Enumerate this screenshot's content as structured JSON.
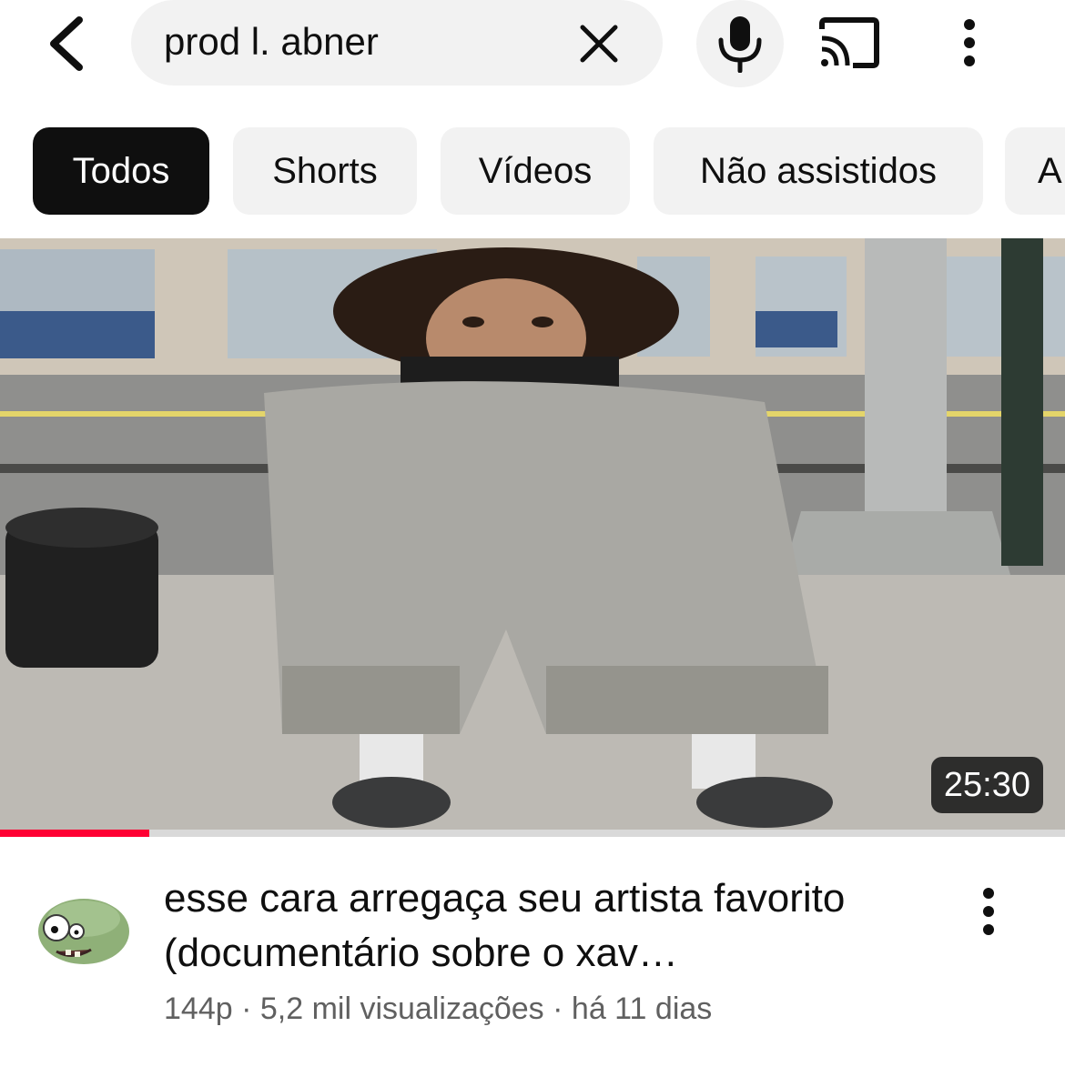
{
  "search": {
    "query": "prod l. abner"
  },
  "icons": {
    "back": "chevron-left-icon",
    "clear": "close-icon",
    "mic": "microphone-icon",
    "cast": "cast-icon",
    "more": "more-vertical-icon"
  },
  "chips": [
    {
      "label": "Todos",
      "active": true
    },
    {
      "label": "Shorts",
      "active": false
    },
    {
      "label": "Vídeos",
      "active": false
    },
    {
      "label": "Não assistidos",
      "active": false
    },
    {
      "label": "A",
      "active": false
    }
  ],
  "video": {
    "duration": "25:30",
    "watched_fraction": 0.14,
    "title": "esse cara arregaça seu artista favorito (documentário sobre o xav…",
    "channel": "144p",
    "views": "5,2 mil visualizações",
    "age": "há 11 dias"
  },
  "colors": {
    "progress": "#ff0033",
    "chip_active_bg": "#0f0f0f",
    "chip_bg": "#f2f2f2",
    "subtext": "#606060"
  }
}
